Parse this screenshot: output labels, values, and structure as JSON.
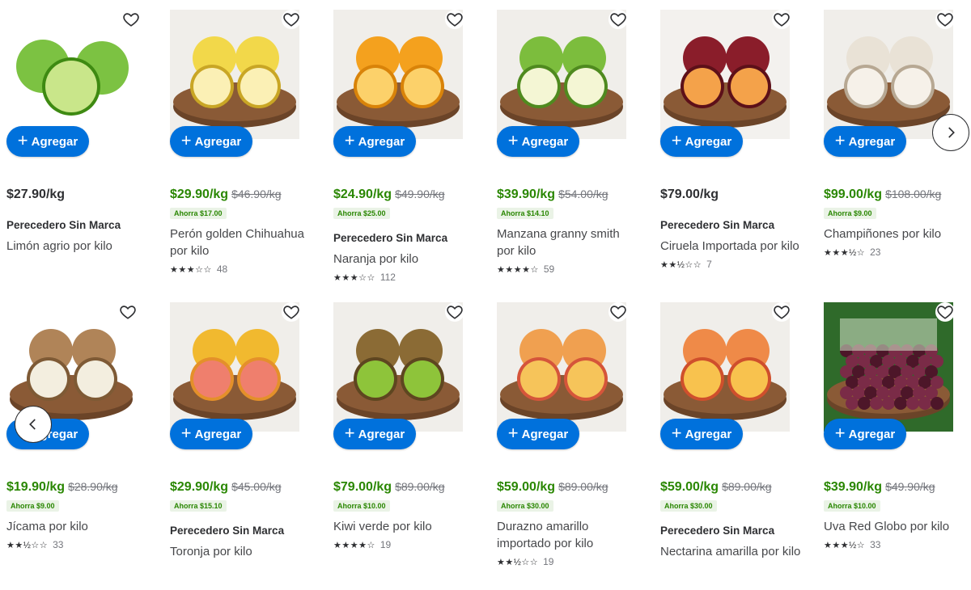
{
  "add_label": "Agregar",
  "nav": {
    "next_icon": "chevron-right-icon",
    "prev_icon": "chevron-left-icon"
  },
  "products": [
    {
      "name": "Limón agrio por kilo",
      "brand": "Perecedero Sin Marca",
      "price": "$27.90/kg",
      "was": "",
      "save": "",
      "stars": "",
      "reviews": "",
      "icon": "lime-image"
    },
    {
      "name": "Perón golden Chihuahua por kilo",
      "brand": "",
      "price": "$29.90/kg",
      "was": "$46.90/kg",
      "save": "Ahorra $17.00",
      "stars": "★★★☆☆",
      "reviews": "48",
      "icon": "apple-golden-image"
    },
    {
      "name": "Naranja por kilo",
      "brand": "Perecedero Sin Marca",
      "price": "$24.90/kg",
      "was": "$49.90/kg",
      "save": "Ahorra $25.00",
      "stars": "★★★☆☆",
      "reviews": "112",
      "icon": "orange-image"
    },
    {
      "name": "Manzana granny smith por kilo",
      "brand": "",
      "price": "$39.90/kg",
      "was": "$54.00/kg",
      "save": "Ahorra $14.10",
      "stars": "★★★★☆",
      "reviews": "59",
      "icon": "green-apple-image"
    },
    {
      "name": "Ciruela Importada por kilo",
      "brand": "Perecedero Sin Marca",
      "price": "$79.00/kg",
      "was": "",
      "save": "",
      "stars": "★★½☆☆",
      "reviews": "7",
      "icon": "plum-image"
    },
    {
      "name": "Champiñones por kilo",
      "brand": "",
      "price": "$99.00/kg",
      "was": "$108.00/kg",
      "save": "Ahorra $9.00",
      "stars": "★★★½☆",
      "reviews": "23",
      "icon": "mushroom-image"
    },
    {
      "name": "Jícama por kilo",
      "brand": "",
      "price": "$19.90/kg",
      "was": "$28.90/kg",
      "save": "Ahorra $9.00",
      "stars": "★★½☆☆",
      "reviews": "33",
      "icon": "jicama-image"
    },
    {
      "name": "Toronja por kilo",
      "brand": "Perecedero Sin Marca",
      "price": "$29.90/kg",
      "was": "$45.00/kg",
      "save": "Ahorra $15.10",
      "stars": "",
      "reviews": "",
      "icon": "grapefruit-image"
    },
    {
      "name": "Kiwi verde por kilo",
      "brand": "",
      "price": "$79.00/kg",
      "was": "$89.00/kg",
      "save": "Ahorra $10.00",
      "stars": "★★★★☆",
      "reviews": "19",
      "icon": "kiwi-image"
    },
    {
      "name": "Durazno amarillo importado por kilo",
      "brand": "",
      "price": "$59.00/kg",
      "was": "$89.00/kg",
      "save": "Ahorra $30.00",
      "stars": "★★½☆☆",
      "reviews": "19",
      "icon": "peach-image"
    },
    {
      "name": "Nectarina amarilla por kilo",
      "brand": "Perecedero Sin Marca",
      "price": "$59.00/kg",
      "was": "$89.00/kg",
      "save": "Ahorra $30.00",
      "stars": "",
      "reviews": "",
      "icon": "nectarine-image"
    },
    {
      "name": "Uva Red Globo por kilo",
      "brand": "",
      "price": "$39.90/kg",
      "was": "$49.90/kg",
      "save": "Ahorra $10.00",
      "stars": "★★★½☆",
      "reviews": "33",
      "icon": "grapes-image"
    }
  ],
  "colors": {
    "primary": "#0071dc",
    "sale": "#2a8703",
    "save_bg": "#eaf3e6"
  }
}
